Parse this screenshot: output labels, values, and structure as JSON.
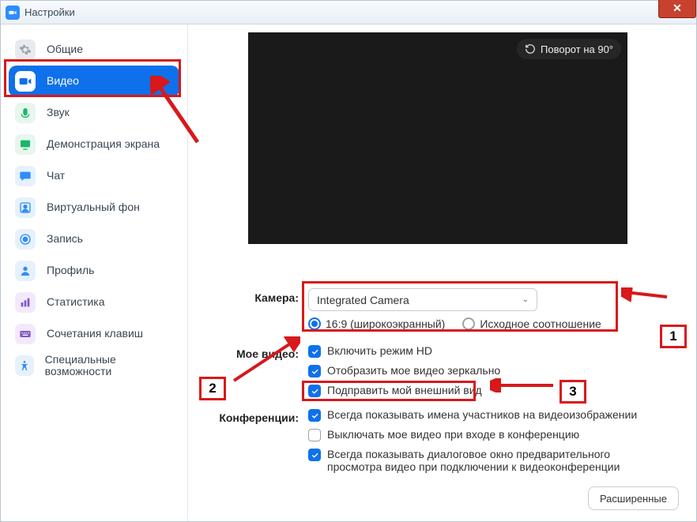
{
  "window": {
    "title": "Настройки"
  },
  "sidebar": {
    "items": [
      {
        "label": "Общие",
        "iconBg": "#e7ebef",
        "glyph": "gear"
      },
      {
        "label": "Видео",
        "iconBg": "#ffffff",
        "glyph": "video",
        "active": true
      },
      {
        "label": "Звук",
        "iconBg": "#e8f6ee",
        "glyph": "audio",
        "glyphColor": "#18b86b"
      },
      {
        "label": "Демонстрация экрана",
        "iconBg": "#e8f6ee",
        "glyph": "share",
        "glyphColor": "#18b86b"
      },
      {
        "label": "Чат",
        "iconBg": "#e6f1fb",
        "glyph": "chat",
        "glyphColor": "#2D8CFF"
      },
      {
        "label": "Виртуальный фон",
        "iconBg": "#e6f1fb",
        "glyph": "bg",
        "glyphColor": "#2D8CFF"
      },
      {
        "label": "Запись",
        "iconBg": "#e6f1fb",
        "glyph": "record",
        "glyphColor": "#2D8CFF"
      },
      {
        "label": "Профиль",
        "iconBg": "#e6f1fb",
        "glyph": "profile",
        "glyphColor": "#2D8CFF"
      },
      {
        "label": "Статистика",
        "iconBg": "#f2eafc",
        "glyph": "stats",
        "glyphColor": "#8256c9"
      },
      {
        "label": "Сочетания клавиш",
        "iconBg": "#f2eafc",
        "glyph": "keys",
        "glyphColor": "#8256c9"
      },
      {
        "label": "Специальные возможности",
        "iconBg": "#e6f1fb",
        "glyph": "access",
        "glyphColor": "#2D8CFF"
      }
    ]
  },
  "preview": {
    "rotateLabel": "Поворот на 90°"
  },
  "camera": {
    "label": "Камера:",
    "selected": "Integrated Camera",
    "ratio169": "16:9 (широкоэкранный)",
    "ratioOriginal": "Исходное соотношение"
  },
  "myVideo": {
    "label": "Мое видео:",
    "hd": "Включить режим HD",
    "mirror": "Отобразить мое видео зеркально",
    "touchup": "Подправить мой внешний вид"
  },
  "meetings": {
    "label": "Конференции:",
    "names": "Всегда показывать имена участников на видеоизображении",
    "offOnJoin": "Выключать мое видео при входе в конференцию",
    "previewDialog": "Всегда показывать диалоговое окно предварительного просмотра видео при подключении к видеоконференции"
  },
  "advanced": "Расширенные",
  "callouts": {
    "n1": "1",
    "n2": "2",
    "n3": "3"
  }
}
